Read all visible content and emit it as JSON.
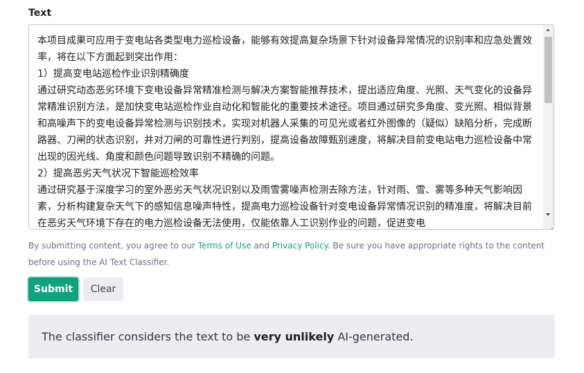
{
  "field": {
    "label": "Text",
    "value": "本项目成果可应用于变电站各类型电力巡检设备，能够有效提高复杂场景下针对设备异常情况的识别率和应急处置效率，将在以下方面起到突出作用：\n1）提高变电站巡检作业识别精确度\n通过研究动态恶劣环境下变电设备异常精准检测与解决方案智能推荐技术，提出适应角度、光照、天气变化的设备异常精准识别方法，是加快变电站巡检作业自动化和智能化的重要技术途径。项目通过研究多角度、变光照、相似背景和高噪声下的变电设备异常检测与识别技术，实现对机器人采集的可见光或者红外图像的（疑似）缺陷分析，完成断路器、刀闸的状态识别，并对刀闸的可靠性进行判别，提高设备故障甄别速度，将解决目前变电站电力巡检设备中常出现的因光线、角度和颜色问题导致识别不精确的问题。\n2）提高恶劣天气状况下智能巡检效率\n通过研究基于深度学习的室外恶劣天气状况识别以及雨雪雾噪声检测去除方法，针对雨、雪、雾等多种天气影响因素，分析构建复杂天气下的感知信息噪声特性，提高电力巡检设备针对变电设备异常情况识别的精准度，将解决目前在恶劣天气环境下存在的电力巡检设备无法使用，仅能依靠人工识别作业的问题，促进变电"
  },
  "disclaimer": {
    "prefix": "By submitting content, you agree to our ",
    "terms_link": "Terms of Use",
    "middle": " and ",
    "privacy_link": "Privacy Policy",
    "suffix": ". Be sure you have appropriate rights to the content before using the AI Text Classifier."
  },
  "buttons": {
    "submit": "Submit",
    "clear": "Clear"
  },
  "result": {
    "prefix": "The classifier considers the text to be ",
    "verdict": "very unlikely",
    "suffix": " AI-generated."
  },
  "colors": {
    "accent": "#10a37f",
    "result_bg": "#ececf1"
  }
}
